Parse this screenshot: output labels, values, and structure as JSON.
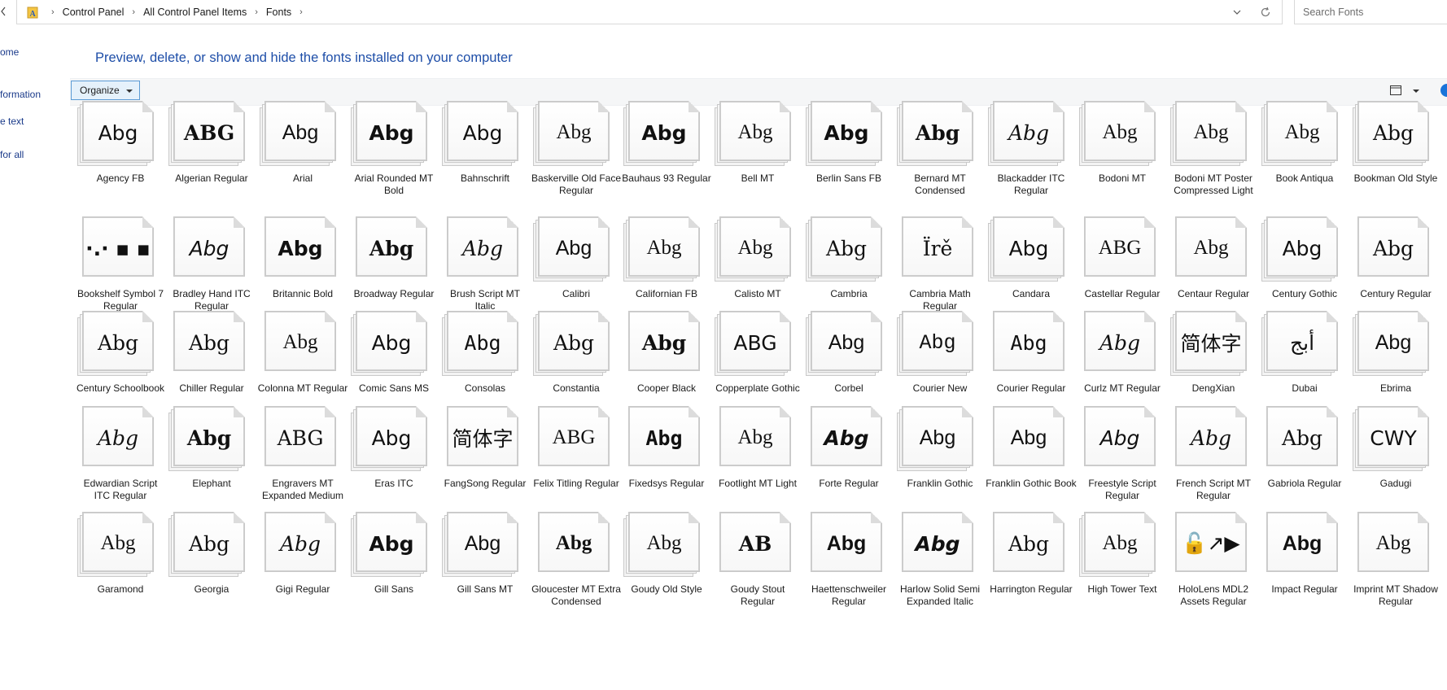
{
  "address": {
    "crumbs": [
      "Control Panel",
      "All Control Panel Items",
      "Fonts"
    ],
    "separator": "›"
  },
  "search": {
    "placeholder": "Search Fonts"
  },
  "left_nav": {
    "items": [
      "ome",
      "formation",
      "e text",
      "for all"
    ]
  },
  "heading": "Preview, delete, or show and hide the fonts installed on your computer",
  "toolbar": {
    "organize_label": "Organize"
  },
  "fonts": [
    {
      "name": "Agency FB",
      "sample": "Abg",
      "family": "\"Liberation Sans Narrow\", \"DejaVu Sans\", sans-serif",
      "weight": "normal",
      "style": "normal",
      "stack": true
    },
    {
      "name": "Algerian Regular",
      "sample": "ABG",
      "family": "\"DejaVu Serif\", serif",
      "weight": "bold",
      "style": "normal",
      "stack": true
    },
    {
      "name": "Arial",
      "sample": "Abg",
      "family": "\"Liberation Sans\", sans-serif",
      "weight": "normal",
      "style": "normal",
      "stack": true
    },
    {
      "name": "Arial Rounded MT Bold",
      "sample": "Abg",
      "family": "\"DejaVu Sans\", sans-serif",
      "weight": "bold",
      "style": "normal",
      "stack": true
    },
    {
      "name": "Bahnschrift",
      "sample": "Abg",
      "family": "\"DejaVu Sans\", sans-serif",
      "weight": "normal",
      "style": "normal",
      "stack": true
    },
    {
      "name": "Baskerville Old Face Regular",
      "sample": "Abg",
      "family": "\"Liberation Serif\", serif",
      "weight": "normal",
      "style": "normal",
      "stack": true
    },
    {
      "name": "Bauhaus 93 Regular",
      "sample": "Abg",
      "family": "\"DejaVu Sans\", sans-serif",
      "weight": "bold",
      "style": "normal",
      "stack": true
    },
    {
      "name": "Bell MT",
      "sample": "Abg",
      "family": "\"Liberation Serif\", serif",
      "weight": "normal",
      "style": "normal",
      "stack": true
    },
    {
      "name": "Berlin Sans FB",
      "sample": "Abg",
      "family": "\"DejaVu Sans\", sans-serif",
      "weight": "bold",
      "style": "normal",
      "stack": true
    },
    {
      "name": "Bernard MT Condensed",
      "sample": "Abg",
      "family": "\"DejaVu Serif\", serif",
      "weight": "bold",
      "style": "normal",
      "stack": true
    },
    {
      "name": "Blackadder ITC Regular",
      "sample": "Abg",
      "family": "\"DejaVu Serif\", serif",
      "weight": "normal",
      "style": "italic",
      "stack": true
    },
    {
      "name": "Bodoni MT",
      "sample": "Abg",
      "family": "\"Liberation Serif\", serif",
      "weight": "normal",
      "style": "normal",
      "stack": true
    },
    {
      "name": "Bodoni MT Poster Compressed Light",
      "sample": "Abg",
      "family": "\"Liberation Serif\", serif",
      "weight": "normal",
      "style": "normal",
      "stack": true
    },
    {
      "name": "Book Antiqua",
      "sample": "Abg",
      "family": "\"Liberation Serif\", serif",
      "weight": "normal",
      "style": "normal",
      "stack": true
    },
    {
      "name": "Bookman Old Style",
      "sample": "Abg",
      "family": "\"DejaVu Serif\", serif",
      "weight": "normal",
      "style": "normal",
      "stack": true
    },
    {
      "name": "Bookshelf Symbol 7 Regular",
      "sample": "·.·  ▪  ▪",
      "family": "\"DejaVu Sans\", sans-serif",
      "weight": "bold",
      "style": "normal",
      "stack": false
    },
    {
      "name": "Bradley Hand ITC Regular",
      "sample": "Abg",
      "family": "\"DejaVu Sans\", sans-serif",
      "weight": "normal",
      "style": "italic",
      "stack": false
    },
    {
      "name": "Britannic Bold",
      "sample": "Abg",
      "family": "\"DejaVu Sans\", sans-serif",
      "weight": "bold",
      "style": "normal",
      "stack": false
    },
    {
      "name": "Broadway Regular",
      "sample": "Abg",
      "family": "\"DejaVu Serif\", serif",
      "weight": "bold",
      "style": "normal",
      "stack": false
    },
    {
      "name": "Brush Script MT Italic",
      "sample": "Abg",
      "family": "\"DejaVu Serif\", serif",
      "weight": "normal",
      "style": "italic",
      "stack": false
    },
    {
      "name": "Calibri",
      "sample": "Abg",
      "family": "\"Liberation Sans\", sans-serif",
      "weight": "normal",
      "style": "normal",
      "stack": true
    },
    {
      "name": "Californian FB",
      "sample": "Abg",
      "family": "\"Liberation Serif\", serif",
      "weight": "normal",
      "style": "normal",
      "stack": true
    },
    {
      "name": "Calisto MT",
      "sample": "Abg",
      "family": "\"Liberation Serif\", serif",
      "weight": "normal",
      "style": "normal",
      "stack": true
    },
    {
      "name": "Cambria",
      "sample": "Abg",
      "family": "\"DejaVu Serif\", serif",
      "weight": "normal",
      "style": "normal",
      "stack": true
    },
    {
      "name": "Cambria Math Regular",
      "sample": "Ïrě",
      "family": "\"DejaVu Serif\", serif",
      "weight": "normal",
      "style": "normal",
      "stack": false
    },
    {
      "name": "Candara",
      "sample": "Abg",
      "family": "\"DejaVu Sans\", sans-serif",
      "weight": "normal",
      "style": "normal",
      "stack": true
    },
    {
      "name": "Castellar Regular",
      "sample": "ABG",
      "family": "\"Liberation Serif\", serif",
      "weight": "normal",
      "style": "normal",
      "stack": false
    },
    {
      "name": "Centaur Regular",
      "sample": "Abg",
      "family": "\"Liberation Serif\", serif",
      "weight": "normal",
      "style": "normal",
      "stack": false
    },
    {
      "name": "Century Gothic",
      "sample": "Abg",
      "family": "\"DejaVu Sans\", sans-serif",
      "weight": "normal",
      "style": "normal",
      "stack": true
    },
    {
      "name": "Century Regular",
      "sample": "Abg",
      "family": "\"DejaVu Serif\", serif",
      "weight": "normal",
      "style": "normal",
      "stack": false
    },
    {
      "name": "Century Schoolbook",
      "sample": "Abg",
      "family": "\"DejaVu Serif\", serif",
      "weight": "normal",
      "style": "normal",
      "stack": true
    },
    {
      "name": "Chiller Regular",
      "sample": "Abg",
      "family": "\"DejaVu Serif\", serif",
      "weight": "normal",
      "style": "normal",
      "stack": false
    },
    {
      "name": "Colonna MT Regular",
      "sample": "Abg",
      "family": "\"Liberation Serif\", serif",
      "weight": "normal",
      "style": "normal",
      "stack": false
    },
    {
      "name": "Comic Sans MS",
      "sample": "Abg",
      "family": "\"DejaVu Sans\", sans-serif",
      "weight": "normal",
      "style": "normal",
      "stack": true
    },
    {
      "name": "Consolas",
      "sample": "Abg",
      "family": "\"DejaVu Sans Mono\", monospace",
      "weight": "normal",
      "style": "normal",
      "stack": true
    },
    {
      "name": "Constantia",
      "sample": "Abg",
      "family": "\"DejaVu Serif\", serif",
      "weight": "normal",
      "style": "normal",
      "stack": true
    },
    {
      "name": "Cooper Black",
      "sample": "Abg",
      "family": "\"DejaVu Serif\", serif",
      "weight": "bold",
      "style": "normal",
      "stack": false
    },
    {
      "name": "Copperplate Gothic",
      "sample": "ABG",
      "family": "\"DejaVu Sans\", sans-serif",
      "weight": "normal",
      "style": "normal",
      "stack": true
    },
    {
      "name": "Corbel",
      "sample": "Abg",
      "family": "\"Liberation Sans\", sans-serif",
      "weight": "normal",
      "style": "normal",
      "stack": true
    },
    {
      "name": "Courier New",
      "sample": "Abg",
      "family": "\"Liberation Mono\", monospace",
      "weight": "normal",
      "style": "normal",
      "stack": true
    },
    {
      "name": "Courier Regular",
      "sample": "Abg",
      "family": "\"DejaVu Sans Mono\", monospace",
      "weight": "normal",
      "style": "normal",
      "stack": false
    },
    {
      "name": "Curlz MT Regular",
      "sample": "Abg",
      "family": "\"DejaVu Serif\", serif",
      "weight": "normal",
      "style": "italic",
      "stack": false
    },
    {
      "name": "DengXian",
      "sample": "简体字",
      "family": "\"DejaVu Sans\", sans-serif",
      "weight": "normal",
      "style": "normal",
      "stack": true
    },
    {
      "name": "Dubai",
      "sample": "أبج",
      "family": "\"DejaVu Sans\", sans-serif",
      "weight": "normal",
      "style": "normal",
      "stack": true
    },
    {
      "name": "Ebrima",
      "sample": "Abg",
      "family": "\"Liberation Sans\", sans-serif",
      "weight": "normal",
      "style": "normal",
      "stack": true
    },
    {
      "name": "Edwardian Script ITC Regular",
      "sample": "Abg",
      "family": "\"DejaVu Serif\", serif",
      "weight": "normal",
      "style": "italic",
      "stack": false
    },
    {
      "name": "Elephant",
      "sample": "Abg",
      "family": "\"DejaVu Serif\", serif",
      "weight": "bold",
      "style": "normal",
      "stack": true
    },
    {
      "name": "Engravers MT Expanded Medium",
      "sample": "ABG",
      "family": "\"DejaVu Serif\", serif",
      "weight": "normal",
      "style": "normal",
      "stack": false
    },
    {
      "name": "Eras ITC",
      "sample": "Abg",
      "family": "\"DejaVu Sans\", sans-serif",
      "weight": "normal",
      "style": "normal",
      "stack": true
    },
    {
      "name": "FangSong Regular",
      "sample": "简体字",
      "family": "\"DejaVu Serif\", serif",
      "weight": "normal",
      "style": "normal",
      "stack": false
    },
    {
      "name": "Felix Titling Regular",
      "sample": "ABG",
      "family": "\"Liberation Serif\", serif",
      "weight": "normal",
      "style": "normal",
      "stack": false
    },
    {
      "name": "Fixedsys Regular",
      "sample": "Abg",
      "family": "\"DejaVu Sans Mono\", monospace",
      "weight": "bold",
      "style": "normal",
      "stack": false
    },
    {
      "name": "Footlight MT Light",
      "sample": "Abg",
      "family": "\"Liberation Serif\", serif",
      "weight": "normal",
      "style": "normal",
      "stack": false
    },
    {
      "name": "Forte Regular",
      "sample": "Abg",
      "family": "\"DejaVu Sans\", sans-serif",
      "weight": "bold",
      "style": "italic",
      "stack": false
    },
    {
      "name": "Franklin Gothic",
      "sample": "Abg",
      "family": "\"Liberation Sans\", sans-serif",
      "weight": "normal",
      "style": "normal",
      "stack": true
    },
    {
      "name": "Franklin Gothic Book",
      "sample": "Abg",
      "family": "\"Liberation Sans\", sans-serif",
      "weight": "normal",
      "style": "normal",
      "stack": false
    },
    {
      "name": "Freestyle Script Regular",
      "sample": "Abg",
      "family": "\"DejaVu Sans\", sans-serif",
      "weight": "normal",
      "style": "italic",
      "stack": false
    },
    {
      "name": "French Script MT Regular",
      "sample": "Abg",
      "family": "\"DejaVu Serif\", serif",
      "weight": "normal",
      "style": "italic",
      "stack": false
    },
    {
      "name": "Gabriola Regular",
      "sample": "Abg",
      "family": "\"DejaVu Serif\", serif",
      "weight": "normal",
      "style": "normal",
      "stack": false
    },
    {
      "name": "Gadugi",
      "sample": "CWY",
      "family": "\"DejaVu Sans\", sans-serif",
      "weight": "normal",
      "style": "normal",
      "stack": true
    },
    {
      "name": "Garamond",
      "sample": "Abg",
      "family": "\"Liberation Serif\", serif",
      "weight": "normal",
      "style": "normal",
      "stack": true
    },
    {
      "name": "Georgia",
      "sample": "Abg",
      "family": "\"DejaVu Serif\", serif",
      "weight": "normal",
      "style": "normal",
      "stack": true
    },
    {
      "name": "Gigi Regular",
      "sample": "Abg",
      "family": "\"DejaVu Serif\", serif",
      "weight": "normal",
      "style": "italic",
      "stack": false
    },
    {
      "name": "Gill Sans",
      "sample": "Abg",
      "family": "\"DejaVu Sans\", sans-serif",
      "weight": "bold",
      "style": "normal",
      "stack": true
    },
    {
      "name": "Gill Sans MT",
      "sample": "Abg",
      "family": "\"Liberation Sans\", sans-serif",
      "weight": "normal",
      "style": "normal",
      "stack": true
    },
    {
      "name": "Gloucester MT Extra Condensed",
      "sample": "Abg",
      "family": "\"Liberation Serif\", serif",
      "weight": "bold",
      "style": "normal",
      "stack": false
    },
    {
      "name": "Goudy Old Style",
      "sample": "Abg",
      "family": "\"Liberation Serif\", serif",
      "weight": "normal",
      "style": "normal",
      "stack": true
    },
    {
      "name": "Goudy Stout Regular",
      "sample": "AB",
      "family": "\"DejaVu Serif\", serif",
      "weight": "bold",
      "style": "normal",
      "stack": false
    },
    {
      "name": "Haettenschweiler Regular",
      "sample": "Abg",
      "family": "\"Liberation Sans\", sans-serif",
      "weight": "bold",
      "style": "normal",
      "stack": false
    },
    {
      "name": "Harlow Solid Semi Expanded Italic",
      "sample": "Abg",
      "family": "\"DejaVu Sans\", sans-serif",
      "weight": "bold",
      "style": "italic",
      "stack": false
    },
    {
      "name": "Harrington Regular",
      "sample": "Abg",
      "family": "\"DejaVu Serif\", serif",
      "weight": "normal",
      "style": "normal",
      "stack": false
    },
    {
      "name": "High Tower Text",
      "sample": "Abg",
      "family": "\"Liberation Serif\", serif",
      "weight": "normal",
      "style": "normal",
      "stack": true
    },
    {
      "name": "HoloLens MDL2 Assets Regular",
      "sample": "🔓↗▶",
      "family": "\"DejaVu Sans\", sans-serif",
      "weight": "normal",
      "style": "normal",
      "stack": false
    },
    {
      "name": "Impact Regular",
      "sample": "Abg",
      "family": "\"Liberation Sans\", sans-serif",
      "weight": "bold",
      "style": "normal",
      "stack": false
    },
    {
      "name": "Imprint MT Shadow Regular",
      "sample": "Abg",
      "family": "\"Liberation Serif\", serif",
      "weight": "normal",
      "style": "normal",
      "stack": false
    }
  ]
}
